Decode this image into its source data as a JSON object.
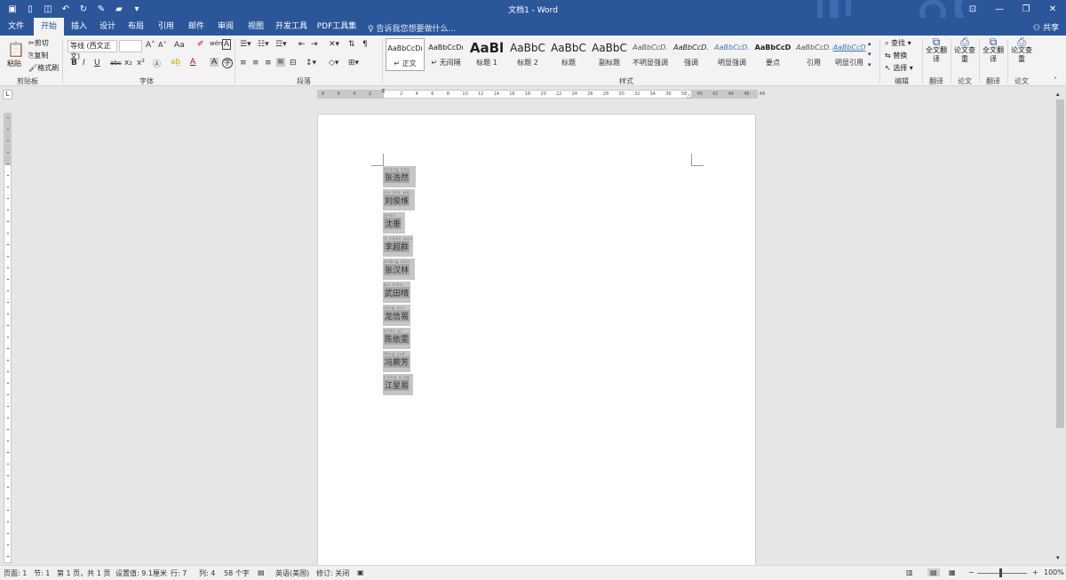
{
  "window": {
    "title": "文档1 - Word"
  },
  "tabs": [
    "文件",
    "开始",
    "插入",
    "设计",
    "布局",
    "引用",
    "邮件",
    "审阅",
    "视图",
    "开发工具",
    "PDF工具集"
  ],
  "active_tab": "开始",
  "tell_me": "告诉我您想要做什么...",
  "share": "共享",
  "clipboard": {
    "paste": "粘贴",
    "cut": "剪切",
    "copy": "复制",
    "format_painter": "格式刷",
    "label": "剪贴板"
  },
  "font": {
    "name": "等线 (西文正文)",
    "size": "",
    "label": "字体",
    "bold": "B",
    "italic": "I",
    "underline": "U",
    "strike": "abc",
    "sub": "x₂",
    "sup": "x²",
    "grow": "A",
    "shrink": "A",
    "case": "Aa",
    "font_color": "A"
  },
  "paragraph": {
    "label": "段落"
  },
  "styles": {
    "label": "样式",
    "items": [
      {
        "sample": "AaBbCcDı",
        "name": "↵ 正文"
      },
      {
        "sample": "AaBbCcDı",
        "name": "↵ 无间隔"
      },
      {
        "sample": "AaBl",
        "name": "标题 1"
      },
      {
        "sample": "AaBbC",
        "name": "标题 2"
      },
      {
        "sample": "AaBbC",
        "name": "标题"
      },
      {
        "sample": "AaBbC",
        "name": "副标题"
      },
      {
        "sample": "AaBbCcD.",
        "name": "不明显强调"
      },
      {
        "sample": "AaBbCcD.",
        "name": "强调"
      },
      {
        "sample": "AaBbCcD.",
        "name": "明显强调"
      },
      {
        "sample": "AaBbCcD",
        "name": "要点"
      },
      {
        "sample": "AaBbCcD.",
        "name": "引用"
      },
      {
        "sample": "AaBbCcD",
        "name": "明显引用"
      }
    ]
  },
  "editing": {
    "find": "查找",
    "replace": "替换",
    "select": "选择",
    "label": "编辑"
  },
  "extra_groups": [
    {
      "btn": "全文翻译",
      "label": "翻译"
    },
    {
      "btn": "论文查重",
      "label": "论文"
    },
    {
      "btn": "全文翻译",
      "label": "翻译"
    },
    {
      "btn": "论文查重",
      "label": "论文"
    }
  ],
  "ruler_h": [
    "8",
    "6",
    "4",
    "2",
    "",
    "2",
    "4",
    "6",
    "8",
    "10",
    "12",
    "14",
    "16",
    "18",
    "20",
    "22",
    "24",
    "26",
    "28",
    "30",
    "32",
    "34",
    "36",
    "38",
    "40",
    "42",
    "44",
    "46",
    "48"
  ],
  "names": [
    {
      "text": "张浩然",
      "phonetic": "zhāng hào rán"
    },
    {
      "text": "刘俊维",
      "phonetic": "liú jùn wéi"
    },
    {
      "text": "沈垂",
      "phonetic": "shěn chuí"
    },
    {
      "text": "李超群",
      "phonetic": "lǐ chāo qún"
    },
    {
      "text": "张汉林",
      "phonetic": "zhāng hàn lín"
    },
    {
      "text": "武田晴",
      "phonetic": "wǔ tián qíng"
    },
    {
      "text": "龙信易",
      "phonetic": "lóng xìn yì"
    },
    {
      "text": "陈依雯",
      "phonetic": "chén yī wén"
    },
    {
      "text": "冯蕨芳",
      "phonetic": "féng jué fāng"
    },
    {
      "text": "江星易",
      "phonetic": "jiāng xīng yì"
    }
  ],
  "status": {
    "page": "页面: 1",
    "section": "节: 1",
    "pages": "第 1 页，共 1 页",
    "setting": "设置值: 9.1厘米",
    "line": "行: 7",
    "col": "列: 4",
    "words": "58 个字",
    "lang": "英语(美国)",
    "track": "修订: 关闭",
    "zoom": "100%"
  }
}
